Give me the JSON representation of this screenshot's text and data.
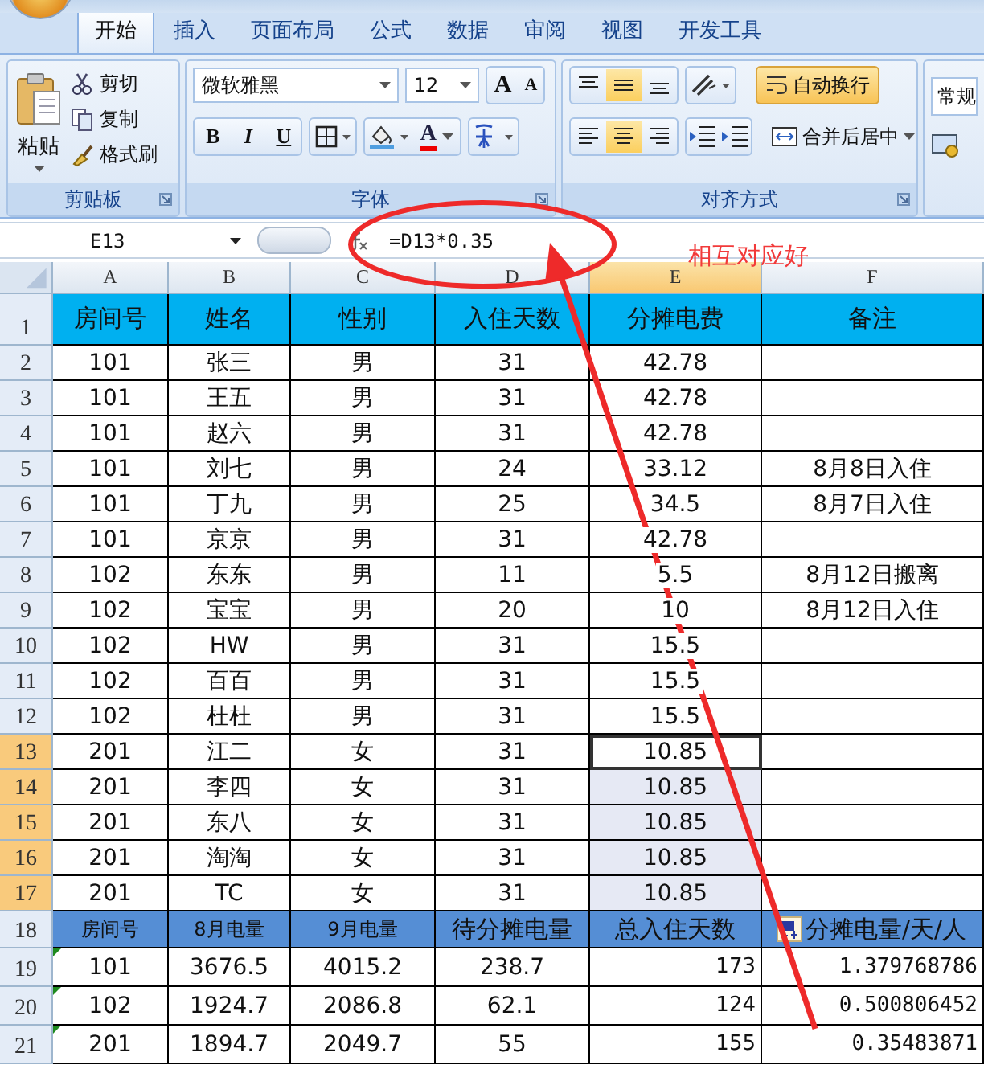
{
  "tabs": [
    {
      "label": "开始",
      "selected": true
    },
    {
      "label": "插入",
      "selected": false
    },
    {
      "label": "页面布局",
      "selected": false
    },
    {
      "label": "公式",
      "selected": false
    },
    {
      "label": "数据",
      "selected": false
    },
    {
      "label": "审阅",
      "selected": false
    },
    {
      "label": "视图",
      "selected": false
    },
    {
      "label": "开发工具",
      "selected": false
    }
  ],
  "ribbon": {
    "clipboard": {
      "title": "剪贴板",
      "paste": "粘贴",
      "actions": [
        "剪切",
        "复制",
        "格式刷"
      ]
    },
    "font": {
      "title": "字体",
      "font_name": "微软雅黑",
      "font_size": "12",
      "grow": "A",
      "shrink": "A",
      "styles": [
        "B",
        "I",
        "U"
      ],
      "color_letter": "A"
    },
    "alignment": {
      "title": "对齐方式",
      "vertical": [
        {
          "selected": false
        },
        {
          "selected": true
        },
        {
          "selected": false
        }
      ],
      "horizontal": [
        {
          "selected": false
        },
        {
          "selected": true
        },
        {
          "selected": false
        }
      ],
      "wrap": {
        "label": "自动换行",
        "on": true
      },
      "merge": "合并后居中"
    },
    "number": {
      "format": "常规"
    }
  },
  "formula_bar": {
    "name_box": "E13",
    "formula": "=D13*0.35"
  },
  "columns": [
    {
      "label": "A",
      "selected": false
    },
    {
      "label": "B",
      "selected": false
    },
    {
      "label": "C",
      "selected": false
    },
    {
      "label": "D",
      "selected": false
    },
    {
      "label": "E",
      "selected": true
    },
    {
      "label": "F",
      "selected": false
    }
  ],
  "rows": [
    {
      "number": "1",
      "kind": "header",
      "selected": false,
      "cells": [
        "房间号",
        "姓名",
        "性别",
        "入住天数",
        "分摊电费",
        "备注"
      ]
    },
    {
      "number": "2",
      "kind": "data",
      "selected": false,
      "cells": [
        "101",
        "张三",
        "男",
        "31",
        "42.78",
        ""
      ]
    },
    {
      "number": "3",
      "kind": "data",
      "selected": false,
      "cells": [
        "101",
        "王五",
        "男",
        "31",
        "42.78",
        ""
      ]
    },
    {
      "number": "4",
      "kind": "data",
      "selected": false,
      "cells": [
        "101",
        "赵六",
        "男",
        "31",
        "42.78",
        ""
      ]
    },
    {
      "number": "5",
      "kind": "data",
      "selected": false,
      "cells": [
        "101",
        "刘七",
        "男",
        "24",
        "33.12",
        "8月8日入住"
      ]
    },
    {
      "number": "6",
      "kind": "data",
      "selected": false,
      "cells": [
        "101",
        "丁九",
        "男",
        "25",
        "34.5",
        "8月7日入住"
      ]
    },
    {
      "number": "7",
      "kind": "data",
      "selected": false,
      "cells": [
        "101",
        "京京",
        "男",
        "31",
        "42.78",
        ""
      ]
    },
    {
      "number": "8",
      "kind": "data",
      "selected": false,
      "cells": [
        "102",
        "东东",
        "男",
        "11",
        "5.5",
        "8月12日搬离"
      ]
    },
    {
      "number": "9",
      "kind": "data",
      "selected": false,
      "cells": [
        "102",
        "宝宝",
        "男",
        "20",
        "10",
        "8月12日入住"
      ]
    },
    {
      "number": "10",
      "kind": "data",
      "selected": false,
      "cells": [
        "102",
        "HW",
        "男",
        "31",
        "15.5",
        ""
      ]
    },
    {
      "number": "11",
      "kind": "data",
      "selected": false,
      "cells": [
        "102",
        "百百",
        "男",
        "31",
        "15.5",
        ""
      ]
    },
    {
      "number": "12",
      "kind": "data",
      "selected": false,
      "cells": [
        "102",
        "杜杜",
        "男",
        "31",
        "15.5",
        ""
      ]
    },
    {
      "number": "13",
      "kind": "data",
      "selected": true,
      "active": true,
      "cells": [
        "201",
        "江二",
        "女",
        "31",
        "10.85",
        ""
      ]
    },
    {
      "number": "14",
      "kind": "data",
      "selected": true,
      "cells": [
        "201",
        "李四",
        "女",
        "31",
        "10.85",
        ""
      ]
    },
    {
      "number": "15",
      "kind": "data",
      "selected": true,
      "cells": [
        "201",
        "东八",
        "女",
        "31",
        "10.85",
        ""
      ]
    },
    {
      "number": "16",
      "kind": "data",
      "selected": true,
      "cells": [
        "201",
        "淘淘",
        "女",
        "31",
        "10.85",
        ""
      ]
    },
    {
      "number": "17",
      "kind": "data",
      "selected": true,
      "cells": [
        "201",
        "TC",
        "女",
        "31",
        "10.85",
        ""
      ]
    },
    {
      "number": "18",
      "kind": "summary_header",
      "selected": false,
      "cells": [
        "房间号",
        "8月电量",
        "9月电量",
        "待分摊电量",
        "总入住天数",
        "分摊电量/天/人"
      ]
    },
    {
      "number": "19",
      "kind": "summary",
      "selected": false,
      "flag": true,
      "cells": [
        "101",
        "3676.5",
        "4015.2",
        "238.7",
        "173",
        "1.379768786"
      ]
    },
    {
      "number": "20",
      "kind": "summary",
      "selected": false,
      "flag": true,
      "cells": [
        "102",
        "1924.7",
        "2086.8",
        "62.1",
        "124",
        "0.500806452"
      ]
    },
    {
      "number": "21",
      "kind": "summary",
      "selected": false,
      "flag": true,
      "cells": [
        "201",
        "1894.7",
        "2049.7",
        "55",
        "155",
        "0.35483871"
      ]
    }
  ],
  "annotation": {
    "note": "相互对应好"
  }
}
